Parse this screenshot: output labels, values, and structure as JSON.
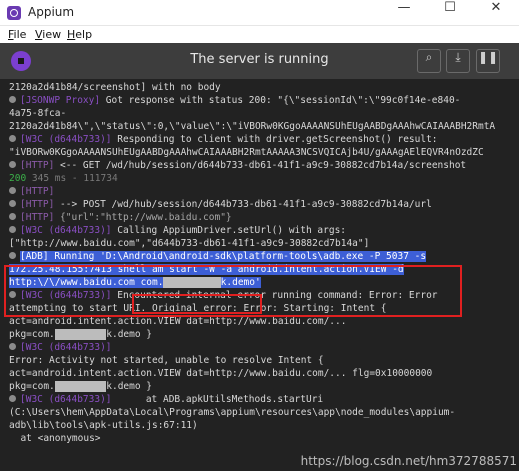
{
  "window": {
    "title": "Appium",
    "minimize": "—",
    "maximize": "☐",
    "close": "✕"
  },
  "menu": [
    "File",
    "View",
    "Help"
  ],
  "header": {
    "status": "The server is running",
    "search_icon": "⌕",
    "download_icon": "⤓",
    "pause_icon": "❚❚"
  },
  "log": [
    {
      "text": "2120a2d41b84/screenshot] with no body"
    },
    {
      "tag": "[JSONWP Proxy]",
      "text": " Got response with status 200: \"{\\\"sessionId\\\":\\\"99c0f14e-e840-",
      "bullet": true
    },
    {
      "text": "4a75-8fca-"
    },
    {
      "text": "2120a2d41b84\\\",\\\"status\\\":0,\\\"value\\\":\\\"iVBORw0KGgoAAAANSUhEUgAABDgAAAhwCAIAAABH2RmtA"
    },
    {
      "tag": "[W3C (d644b733)]",
      "text": " Responding to client with driver.getScreenshot() result:",
      "bullet": true
    },
    {
      "text": "\"iVBORw0KGgoAAAANSUhEUgAABDgAAAhwCAIAAABH2RmtAAAAA3NCSVQICAjb4U/gAAAgAElEQVR4nOzdZC"
    },
    {
      "tag": "[HTTP]",
      "text": " <-- GET /wd/hub/session/d644b733-db61-41f1-a9c9-30882cd7b14a/screenshot",
      "bullet": true
    },
    {
      "green": "200",
      "timing": " 345 ms - 111734"
    },
    {
      "tag": "[HTTP]",
      "text": "",
      "bullet": true
    },
    {
      "tag": "[HTTP]",
      "text": " --> POST /wd/hub/session/d644b733-db61-41f1-a9c9-30882cd7b14a/url",
      "bullet": true
    },
    {
      "tag": "[HTTP]",
      "dimtext": " {\"url\":\"http://www.baidu.com\"}",
      "bullet": true
    },
    {
      "tag": "[W3C (d644b733)]",
      "text": " Calling AppiumDriver.setUrl() with args:",
      "bullet": true
    },
    {
      "text": "[\"http://www.baidu.com\",\"d644b733-db61-41f1-a9c9-30882cd7b14a\"]"
    },
    {
      "sel": "[ADB] Running 'D:\\Android\\android-sdk\\platform-tools\\adb.exe -P 5037 -s",
      "bullet": true
    },
    {
      "sel": "172.25.48.155:7413 shell am start -W -a android.intent.action.VIEW -d"
    },
    {
      "sel": "http:\\/\\/www.baidu.com ",
      "box": "com.",
      "blur": "xxxxxxxxxx",
      "box_end": "k.demo'"
    },
    {
      "tag": "[W3C (d644b733)]",
      "text": " Encountered internal error running command: Error: Error",
      "bullet": true
    },
    {
      "text": "attempting to start URI. Original error: Error: Starting: Intent {"
    },
    {
      "text": "act=android.intent.action.VIEW dat=http://www.baidu.com/..."
    },
    {
      "pre": "pkg=com.",
      "blur": "xxxxxxxxx",
      "post": "k.demo }"
    },
    {
      "tag": "[W3C (d644b733)]",
      "text": "",
      "bullet": true
    },
    {
      "text": "Error: Activity not started, unable to resolve Intent {"
    },
    {
      "text": "act=android.intent.action.VIEW dat=http://www.baidu.com/... flg=0x10000000"
    },
    {
      "pre": "pkg=com.",
      "blur": "xxxxxxxxx",
      "post": "k.demo }"
    },
    {
      "tag": "[W3C (d644b733)]",
      "text": "      at ADB.apkUtilsMethods.startUri",
      "bullet": true
    },
    {
      "text": "(C:\\Users\\hem\\AppData\\Local\\Programs\\appium\\resources\\app\\node_modules\\appium-"
    },
    {
      "text": "adb\\lib\\tools\\apk-utils.js:67:11)"
    },
    {
      "text": "  at <anonymous>"
    }
  ],
  "watermark": "https://blog.csdn.net/hm372788571"
}
